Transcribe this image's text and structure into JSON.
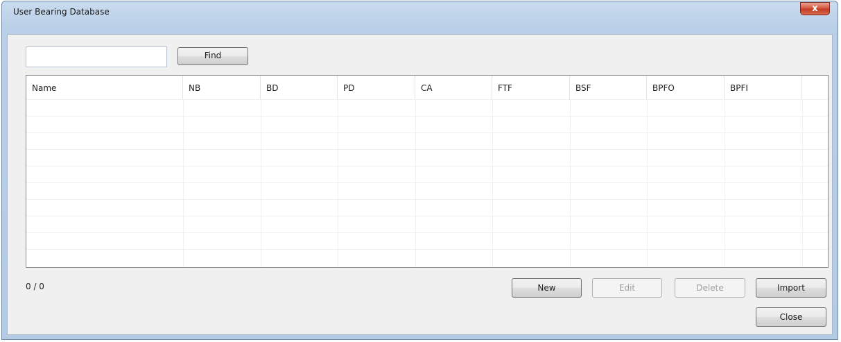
{
  "window": {
    "title": "User Bearing Database",
    "close_glyph": "x",
    "close_icon": "close-icon"
  },
  "search": {
    "value": "",
    "placeholder": "",
    "find_label": "Find"
  },
  "table": {
    "columns": [
      "Name",
      "NB",
      "BD",
      "PD",
      "CA",
      "FTF",
      "BSF",
      "BPFO",
      "BPFI"
    ],
    "rows": []
  },
  "status": {
    "count_text": "0 / 0"
  },
  "actions": {
    "new_label": "New",
    "edit_label": "Edit",
    "delete_label": "Delete",
    "import_label": "Import",
    "close_label": "Close"
  }
}
